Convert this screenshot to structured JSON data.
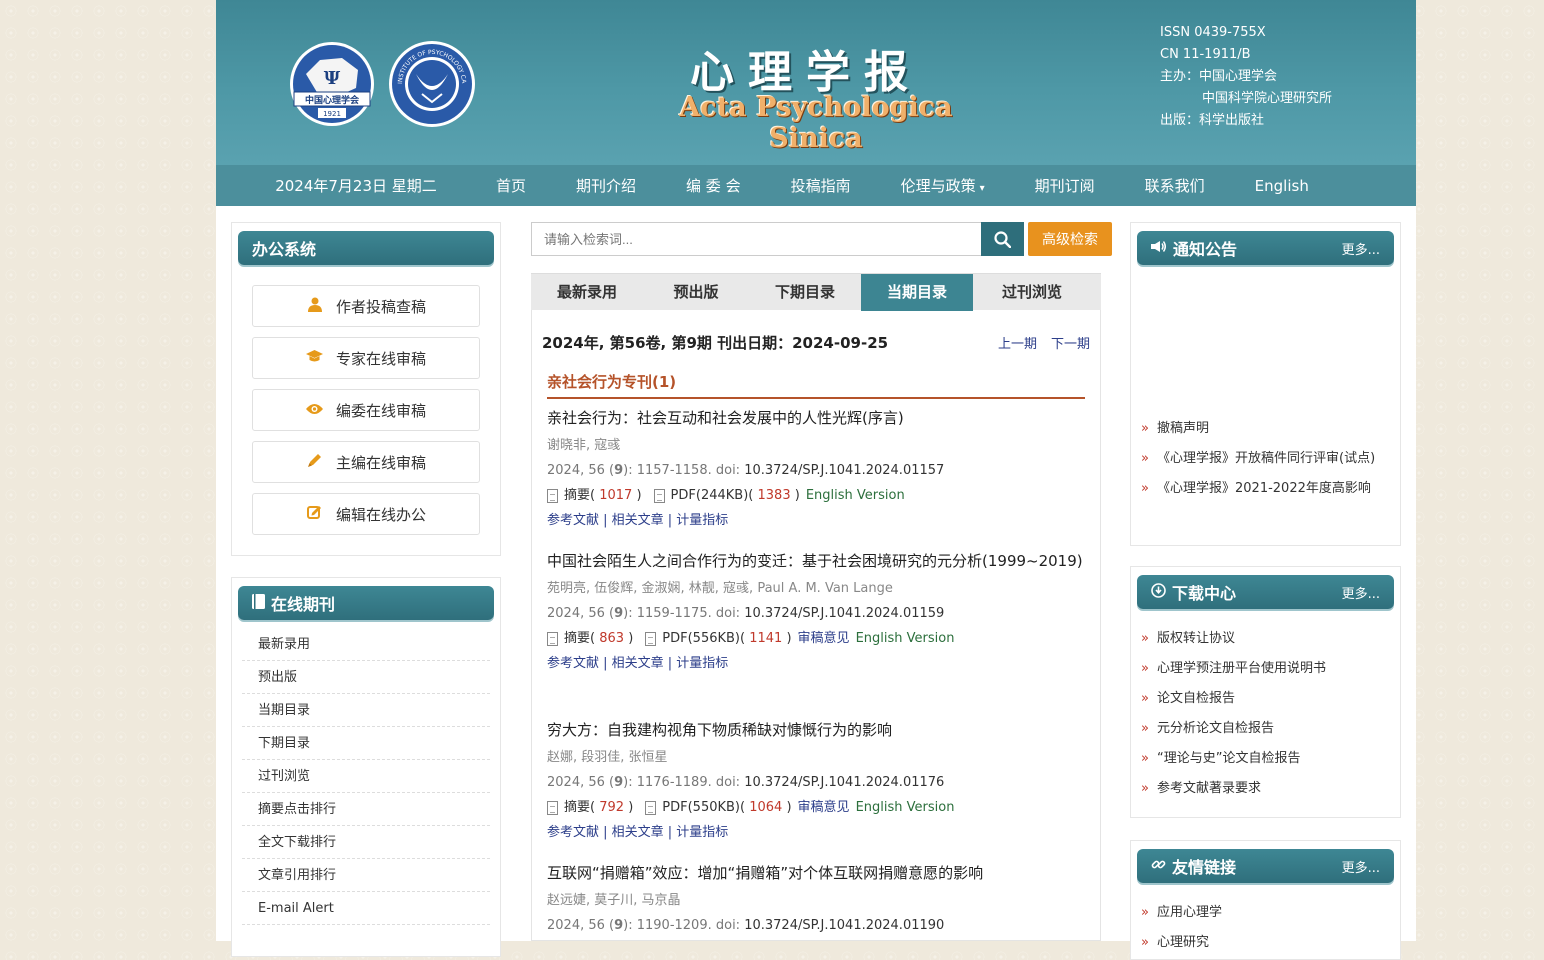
{
  "header": {
    "title_cn": "心理学报",
    "title_en": "Acta Psychologica Sinica",
    "logo1_text": "中国心理学会",
    "logo1_year": "1921",
    "logo2_text": "INSTITUTE OF PSYCHOLOGY CAS",
    "issn": "ISSN 0439-755X",
    "cn": "CN 11-1911/B",
    "sponsor_label": "主办：中国心理学会",
    "sponsor2": "中国科学院心理研究所",
    "publisher": "出版：科学出版社"
  },
  "nav": {
    "date": "2024年7月23日 星期二",
    "items": [
      "首页",
      "期刊介绍",
      "编 委 会",
      "投稿指南",
      "伦理与政策",
      "期刊订阅",
      "联系我们",
      "English"
    ],
    "caret": "▾"
  },
  "office": {
    "title": "办公系统",
    "buttons": [
      "作者投稿查稿",
      "专家在线审稿",
      "编委在线审稿",
      "主编在线审稿",
      "编辑在线办公"
    ]
  },
  "online": {
    "title": "在线期刊",
    "items": [
      "最新录用",
      "预出版",
      "当期目录",
      "下期目录",
      "过刊浏览",
      "摘要点击排行",
      "全文下载排行",
      "文章引用排行",
      "E-mail Alert"
    ]
  },
  "search": {
    "placeholder": "请输入检索词...",
    "advanced": "高级检索"
  },
  "tabs": [
    "最新录用",
    "预出版",
    "下期目录",
    "当期目录",
    "过刊浏览"
  ],
  "issue": {
    "line": "2024年, 第56卷, 第9期    刊出日期：2024-09-25",
    "prev": "上一期",
    "next": "下一期",
    "section": "亲社会行为专刊(1)"
  },
  "labels": {
    "abstract": "摘要",
    "refs": "参考文献 | 相关文章 | 计量指标",
    "english": "English Version",
    "review": "审稿意见",
    "paren_open": "( ",
    "paren_close": " )"
  },
  "articles": [
    {
      "title": "亲社会行为：社会互动和社会发展中的人性光辉(序言)",
      "authors": "谢晓非, 寇彧",
      "cite_prefix": "2024, 56 (",
      "cite_issue": "9",
      "cite_pages": "): 1157-1158.  doi: ",
      "doi": "10.3724/SP.J.1041.2024.01157",
      "abstract_count": "1017",
      "pdf": "PDF(244KB)",
      "pdf_count": "1383",
      "review": false
    },
    {
      "title": "中国社会陌生人之间合作行为的变迁：基于社会困境研究的元分析(1999~2019)",
      "authors": "苑明亮, 伍俊辉, 金淑娴, 林靓, 寇彧, Paul A. M. Van Lange",
      "cite_prefix": "2024, 56 (",
      "cite_issue": "9",
      "cite_pages": "): 1159-1175.  doi: ",
      "doi": "10.3724/SP.J.1041.2024.01159",
      "abstract_count": "863",
      "pdf": "PDF(556KB)",
      "pdf_count": "1141",
      "review": true
    },
    {
      "title": "穷大方：自我建构视角下物质稀缺对慷慨行为的影响",
      "authors": "赵娜, 段羽佳, 张恒星",
      "cite_prefix": "2024, 56 (",
      "cite_issue": "9",
      "cite_pages": "): 1176-1189.  doi: ",
      "doi": "10.3724/SP.J.1041.2024.01176",
      "abstract_count": "792",
      "pdf": "PDF(550KB)",
      "pdf_count": "1064",
      "review": true
    },
    {
      "title": "互联网“捐赠箱”效应：增加“捐赠箱”对个体互联网捐赠意愿的影响",
      "authors": "赵远婕, 莫子川, 马京晶",
      "cite_prefix": "2024, 56 (",
      "cite_issue": "9",
      "cite_pages": "): 1190-1209.  doi: ",
      "doi": "10.3724/SP.J.1041.2024.01190"
    }
  ],
  "notice": {
    "title": "通知公告",
    "more": "更多...",
    "items": [
      "撤稿声明",
      "《心理学报》开放稿件同行评审(试点)",
      "《心理学报》2021-2022年度高影响"
    ]
  },
  "download": {
    "title": "下载中心",
    "more": "更多...",
    "items": [
      "版权转让协议",
      "心理学预注册平台使用说明书",
      "论文自检报告",
      "元分析论文自检报告",
      "“理论与史”论文自检报告",
      "参考文献著录要求"
    ]
  },
  "links": {
    "title": "友情链接",
    "more": "更多...",
    "items": [
      "应用心理学",
      "心理研究"
    ]
  },
  "colors": {
    "teal_dark": "#2f6f7c",
    "teal": "#4c8f9c",
    "orange": "#e8921e",
    "accent_red": "#c0392b",
    "section_brown": "#b5532a"
  }
}
